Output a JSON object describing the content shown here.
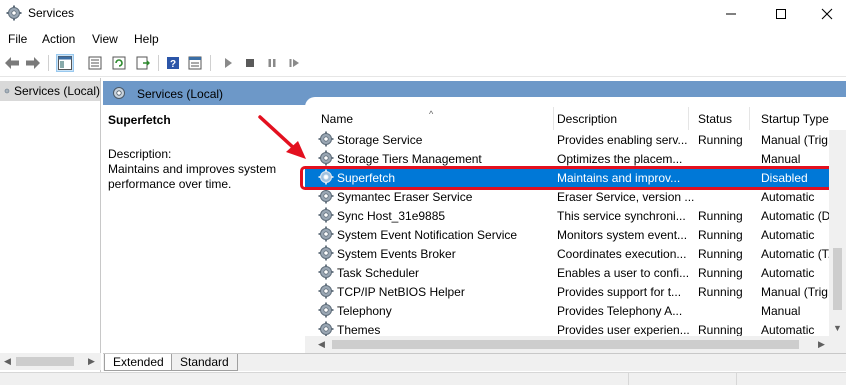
{
  "window": {
    "title": "Services"
  },
  "menu": [
    "File",
    "Action",
    "View",
    "Help"
  ],
  "tree": {
    "selected_label": "Services (Local)"
  },
  "panel": {
    "header": "Services (Local)"
  },
  "details": {
    "service_name": "Superfetch",
    "description_label": "Description:",
    "description_text": "Maintains and improves system performance over time."
  },
  "table": {
    "columns": [
      "Name",
      "Description",
      "Status",
      "Startup Type"
    ],
    "rows": [
      {
        "name": "Storage Service",
        "description": "Provides enabling serv...",
        "status": "Running",
        "startup": "Manual (Trig..."
      },
      {
        "name": "Storage Tiers Management",
        "description": "Optimizes the placem...",
        "status": "",
        "startup": "Manual"
      },
      {
        "name": "Superfetch",
        "description": "Maintains and improv...",
        "status": "",
        "startup": "Disabled"
      },
      {
        "name": "Symantec Eraser Service",
        "description": "Eraser Service, version ...",
        "status": "",
        "startup": "Automatic"
      },
      {
        "name": "Sync Host_31e9885",
        "description": "This service synchroni...",
        "status": "Running",
        "startup": "Automatic (D..."
      },
      {
        "name": "System Event Notification Service",
        "description": "Monitors system event...",
        "status": "Running",
        "startup": "Automatic"
      },
      {
        "name": "System Events Broker",
        "description": "Coordinates execution...",
        "status": "Running",
        "startup": "Automatic (T..."
      },
      {
        "name": "Task Scheduler",
        "description": "Enables a user to confi...",
        "status": "Running",
        "startup": "Automatic"
      },
      {
        "name": "TCP/IP NetBIOS Helper",
        "description": "Provides support for t...",
        "status": "Running",
        "startup": "Manual (Trig..."
      },
      {
        "name": "Telephony",
        "description": "Provides Telephony A...",
        "status": "",
        "startup": "Manual"
      },
      {
        "name": "Themes",
        "description": "Provides user experien...",
        "status": "Running",
        "startup": "Automatic"
      }
    ],
    "selected_row": 2
  },
  "tabs": [
    "Extended",
    "Standard"
  ],
  "colors": {
    "selection": "#0078d7",
    "panel_header": "#6d98c8",
    "highlight_box": "#e3101f",
    "arrow": "#e3101f"
  }
}
